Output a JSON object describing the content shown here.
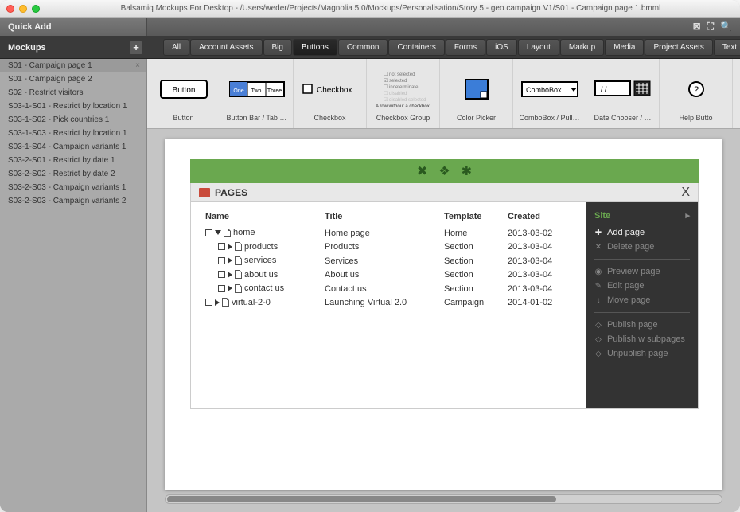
{
  "titlebar": {
    "title": "Balsamiq Mockups For Desktop - /Users/weder/Projects/Magnolia 5.0/Mockups/Personalisation/Story 5 - geo campaign V1/S01 - Campaign page 1.bmml"
  },
  "actionbar": {
    "quick_add": "Quick Add"
  },
  "filter": {
    "heading": "Mockups",
    "tabs": [
      "All",
      "Account Assets",
      "Big",
      "Buttons",
      "Common",
      "Containers",
      "Forms",
      "iOS",
      "Layout",
      "Markup",
      "Media",
      "Project Assets",
      "Text"
    ],
    "active_index": 3
  },
  "sidebar": {
    "items": [
      "S01 - Campaign page 1",
      "S01 - Campaign page 2",
      "S02 - Restrict visitors",
      "S03-1-S01 - Restrict by location 1",
      "S03-1-S02 - Pick countries 1",
      "S03-1-S03 - Restrict by location 1",
      "S03-1-S04 - Campaign variants 1",
      "S03-2-S01 - Restrict by date 1",
      "S03-2-S02 - Restrict by date 2",
      "S03-2-S03 - Campaign variants 1",
      "S03-2-S03 - Campaign variants 2"
    ],
    "selected_index": 0
  },
  "library": {
    "items": [
      {
        "name": "Button",
        "thumb": "button"
      },
      {
        "name": "Button Bar / Tab …",
        "thumb": "bbar"
      },
      {
        "name": "Checkbox",
        "thumb": "checkbox"
      },
      {
        "name": "Checkbox Group",
        "thumb": "cbgroup"
      },
      {
        "name": "Color Picker",
        "thumb": "color"
      },
      {
        "name": "ComboBox / Pull…",
        "thumb": "combo"
      },
      {
        "name": "Date Chooser / …",
        "thumb": "date"
      },
      {
        "name": "Help Butto",
        "thumb": "help"
      }
    ]
  },
  "mockup": {
    "pages_label": "PAGES",
    "headers": {
      "name": "Name",
      "title": "Title",
      "template": "Template",
      "created": "Created"
    },
    "rows": [
      {
        "indent": 0,
        "open": true,
        "name": "home",
        "title": "Home page",
        "template": "Home",
        "created": "2013-03-02"
      },
      {
        "indent": 1,
        "open": false,
        "name": "products",
        "title": "Products",
        "template": "Section",
        "created": "2013-03-04"
      },
      {
        "indent": 1,
        "open": false,
        "name": "services",
        "title": "Services",
        "template": "Section",
        "created": "2013-03-04"
      },
      {
        "indent": 1,
        "open": false,
        "name": "about us",
        "title": "About us",
        "template": "Section",
        "created": "2013-03-04"
      },
      {
        "indent": 1,
        "open": false,
        "name": "contact us",
        "title": "Contact us",
        "template": "Section",
        "created": "2013-03-04"
      },
      {
        "indent": 0,
        "open": false,
        "name": "virtual-2-0",
        "title": "Launching Virtual 2.0",
        "template": "Campaign",
        "created": "2014-01-02"
      }
    ],
    "sidepanel": {
      "header": "Site",
      "actions": [
        {
          "label": "Add page",
          "icon": "✚",
          "active": true
        },
        {
          "label": "Delete page",
          "icon": "✕",
          "active": false
        }
      ],
      "group2": [
        {
          "label": "Preview page",
          "icon": "◉",
          "active": false
        },
        {
          "label": "Edit page",
          "icon": "✎",
          "active": false
        },
        {
          "label": "Move page",
          "icon": "↕",
          "active": false
        }
      ],
      "group3": [
        {
          "label": "Publish page",
          "icon": "◇",
          "active": false
        },
        {
          "label": "Publish w subpages",
          "icon": "◇",
          "active": false
        },
        {
          "label": "Unpublish page",
          "icon": "◇",
          "active": false
        }
      ]
    }
  }
}
